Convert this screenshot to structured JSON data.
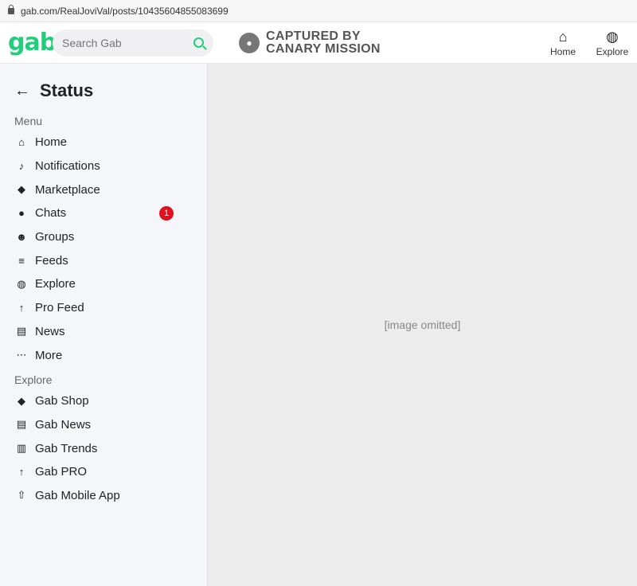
{
  "browser": {
    "url": "gab.com/RealJoviVal/posts/104356048550836​99"
  },
  "header": {
    "logo": "gab",
    "search_placeholder": "Search Gab",
    "watermark_line1": "CAPTURED BY",
    "watermark_line2": "CANARY MISSION",
    "nav": [
      {
        "label": "Home",
        "icon": "home-icon"
      },
      {
        "label": "Explore",
        "icon": "globe-icon"
      }
    ]
  },
  "sidebar": {
    "title": "Status",
    "menu_heading": "Menu",
    "menu": [
      {
        "label": "Home",
        "icon": "home-icon"
      },
      {
        "label": "Notifications",
        "icon": "bell-icon"
      },
      {
        "label": "Marketplace",
        "icon": "tag-icon"
      },
      {
        "label": "Chats",
        "icon": "chat-icon",
        "badge": "1"
      },
      {
        "label": "Groups",
        "icon": "groups-icon"
      },
      {
        "label": "Feeds",
        "icon": "list-icon"
      },
      {
        "label": "Explore",
        "icon": "globe-icon"
      },
      {
        "label": "Pro Feed",
        "icon": "arrow-up-icon"
      },
      {
        "label": "News",
        "icon": "document-icon"
      },
      {
        "label": "More",
        "icon": "more-icon"
      }
    ],
    "explore_heading": "Explore",
    "explore": [
      {
        "label": "Gab Shop",
        "icon": "tag-icon"
      },
      {
        "label": "Gab News",
        "icon": "document-icon"
      },
      {
        "label": "Gab Trends",
        "icon": "trends-icon"
      },
      {
        "label": "Gab PRO",
        "icon": "arrow-up-icon"
      },
      {
        "label": "Gab Mobile App",
        "icon": "share-icon"
      }
    ]
  },
  "colors": {
    "brand": "#21cf7a",
    "badge": "#e0101e"
  }
}
